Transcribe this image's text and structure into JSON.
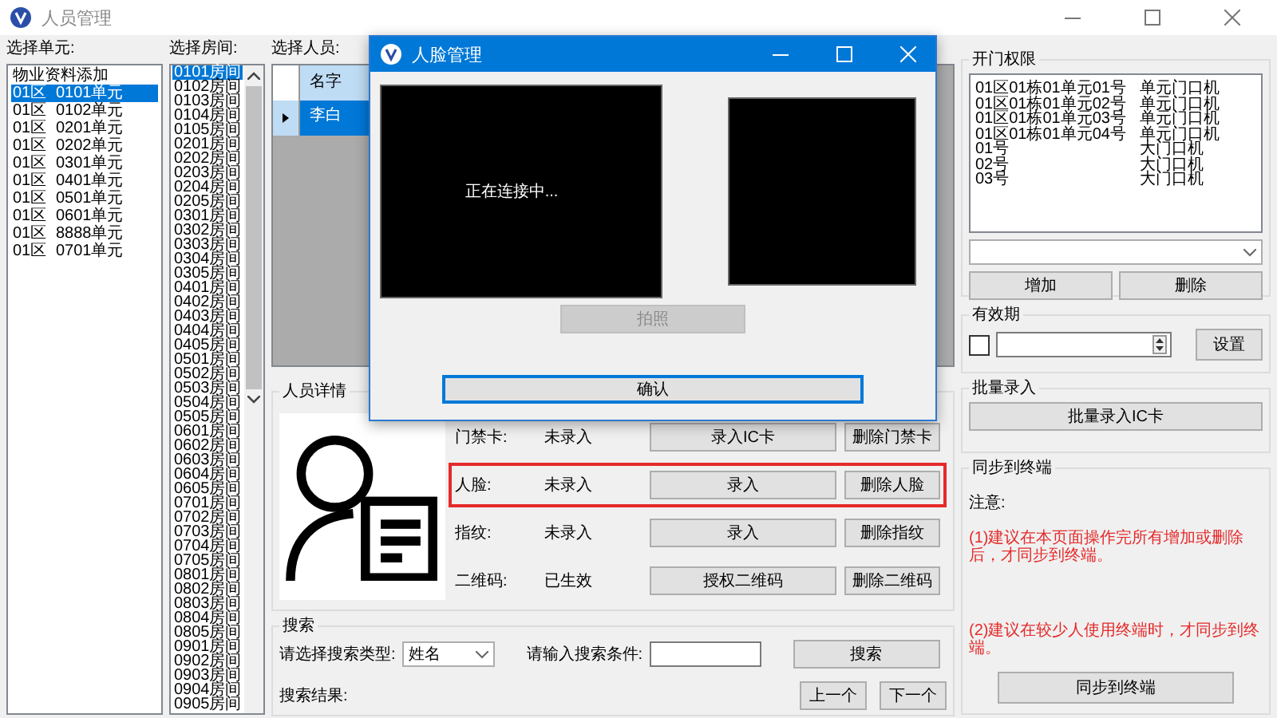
{
  "window": {
    "title": "人员管理"
  },
  "units": {
    "label": "选择单元:",
    "items": [
      {
        "columns": [
          "物业资料添加"
        ],
        "selected": false
      },
      {
        "columns": [
          "01区",
          "0101单元"
        ],
        "selected": true
      },
      {
        "columns": [
          "01区",
          "0102单元"
        ],
        "selected": false
      },
      {
        "columns": [
          "01区",
          "0201单元"
        ],
        "selected": false
      },
      {
        "columns": [
          "01区",
          "0202单元"
        ],
        "selected": false
      },
      {
        "columns": [
          "01区",
          "0301单元"
        ],
        "selected": false
      },
      {
        "columns": [
          "01区",
          "0401单元"
        ],
        "selected": false
      },
      {
        "columns": [
          "01区",
          "0501单元"
        ],
        "selected": false
      },
      {
        "columns": [
          "01区",
          "0601单元"
        ],
        "selected": false
      },
      {
        "columns": [
          "01区",
          "8888单元"
        ],
        "selected": false
      },
      {
        "columns": [
          "01区",
          "0701单元"
        ],
        "selected": false
      }
    ]
  },
  "rooms": {
    "label": "选择房间:",
    "items": [
      {
        "text": "0101房间",
        "selected": true
      },
      {
        "text": "0102房间",
        "selected": false
      },
      {
        "text": "0103房间",
        "selected": false
      },
      {
        "text": "0104房间",
        "selected": false
      },
      {
        "text": "0105房间",
        "selected": false
      },
      {
        "text": "0201房间",
        "selected": false
      },
      {
        "text": "0202房间",
        "selected": false
      },
      {
        "text": "0203房间",
        "selected": false
      },
      {
        "text": "0204房间",
        "selected": false
      },
      {
        "text": "0205房间",
        "selected": false
      },
      {
        "text": "0301房间",
        "selected": false
      },
      {
        "text": "0302房间",
        "selected": false
      },
      {
        "text": "0303房间",
        "selected": false
      },
      {
        "text": "0304房间",
        "selected": false
      },
      {
        "text": "0305房间",
        "selected": false
      },
      {
        "text": "0401房间",
        "selected": false
      },
      {
        "text": "0402房间",
        "selected": false
      },
      {
        "text": "0403房间",
        "selected": false
      },
      {
        "text": "0404房间",
        "selected": false
      },
      {
        "text": "0405房间",
        "selected": false
      },
      {
        "text": "0501房间",
        "selected": false
      },
      {
        "text": "0502房间",
        "selected": false
      },
      {
        "text": "0503房间",
        "selected": false
      },
      {
        "text": "0504房间",
        "selected": false
      },
      {
        "text": "0505房间",
        "selected": false
      },
      {
        "text": "0601房间",
        "selected": false
      },
      {
        "text": "0602房间",
        "selected": false
      },
      {
        "text": "0603房间",
        "selected": false
      },
      {
        "text": "0604房间",
        "selected": false
      },
      {
        "text": "0605房间",
        "selected": false
      },
      {
        "text": "0701房间",
        "selected": false
      },
      {
        "text": "0702房间",
        "selected": false
      },
      {
        "text": "0703房间",
        "selected": false
      },
      {
        "text": "0704房间",
        "selected": false
      },
      {
        "text": "0705房间",
        "selected": false
      },
      {
        "text": "0801房间",
        "selected": false
      },
      {
        "text": "0802房间",
        "selected": false
      },
      {
        "text": "0803房间",
        "selected": false
      },
      {
        "text": "0804房间",
        "selected": false
      },
      {
        "text": "0805房间",
        "selected": false
      },
      {
        "text": "0901房间",
        "selected": false
      },
      {
        "text": "0902房间",
        "selected": false
      },
      {
        "text": "0903房间",
        "selected": false
      },
      {
        "text": "0904房间",
        "selected": false
      },
      {
        "text": "0905房间",
        "selected": false
      }
    ]
  },
  "persons": {
    "label": "选择人员:",
    "columns": [
      "名字"
    ],
    "rows": [
      {
        "name": "李白",
        "selected": true
      }
    ]
  },
  "details": {
    "title": "人员详情",
    "rows": [
      {
        "label": "门禁卡:",
        "status": "未录入",
        "action": "录入IC卡",
        "delete": "删除门禁卡",
        "highlighted": false
      },
      {
        "label": "人脸:",
        "status": "未录入",
        "action": "录入",
        "delete": "删除人脸",
        "highlighted": true
      },
      {
        "label": "指纹:",
        "status": "未录入",
        "action": "录入",
        "delete": "删除指纹",
        "highlighted": false
      },
      {
        "label": "二维码:",
        "status": "已生效",
        "action": "授权二维码",
        "delete": "删除二维码",
        "highlighted": false
      }
    ]
  },
  "search": {
    "title": "搜索",
    "type_label": "请选择搜索类型:",
    "type_value": "姓名",
    "condition_label": "请输入搜索条件:",
    "button": "搜索",
    "result_label": "搜索结果:",
    "prev": "上一个",
    "next": "下一个"
  },
  "access": {
    "title": "开门权限",
    "items": [
      {
        "device": "01区01栋01单元01号",
        "type": "单元门口机"
      },
      {
        "device": "01区01栋01单元02号",
        "type": "单元门口机"
      },
      {
        "device": "01区01栋01单元03号",
        "type": "单元门口机"
      },
      {
        "device": "01区01栋01单元04号",
        "type": "单元门口机"
      },
      {
        "device": "01号",
        "type": "大门口机"
      },
      {
        "device": "02号",
        "type": "大门口机"
      },
      {
        "device": "03号",
        "type": "大门口机"
      }
    ],
    "add": "增加",
    "delete": "删除"
  },
  "validity": {
    "title": "有效期",
    "checked": false,
    "button": "设置"
  },
  "batch": {
    "title": "批量录入",
    "button": "批量录入IC卡"
  },
  "sync": {
    "title": "同步到终端",
    "note_label": "注意:",
    "notes": [
      "(1)建议在本页面操作完所有增加或删除后，才同步到终端。",
      "(2)建议在较少人使用终端时，才同步到终端。"
    ],
    "button": "同步到终端"
  },
  "dialog": {
    "title": "人脸管理",
    "status": "正在连接中...",
    "capture": {
      "label": "拍照",
      "disabled": true
    },
    "confirm": "确认"
  }
}
